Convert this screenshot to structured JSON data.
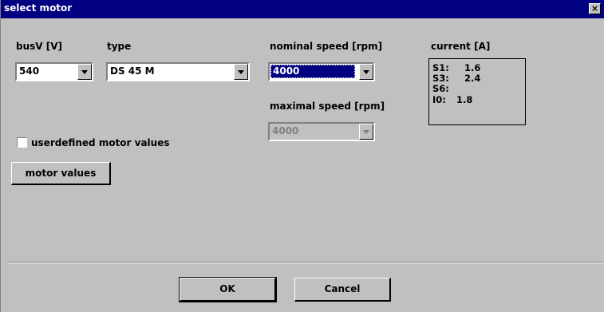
{
  "window": {
    "title": "select motor",
    "close_glyph": "×"
  },
  "busv": {
    "label": "busV [V]",
    "value": "540"
  },
  "type": {
    "label": "type",
    "value": "DS 45 M"
  },
  "nominal_speed": {
    "label": "nominal speed [rpm]",
    "value": "4000"
  },
  "maximal_speed": {
    "label": "maximal speed [rpm]",
    "value": "4000"
  },
  "current": {
    "label": "current [A]",
    "s1_label": "S1:",
    "s1_value": "1.6",
    "s3_label": "S3:",
    "s3_value": "2.4",
    "s6_label": "S6:",
    "s6_value": "",
    "i0_label": "I0:",
    "i0_value": "1.8"
  },
  "userdefined": {
    "label": "userdefined motor values",
    "checked": false
  },
  "buttons": {
    "motor_values": "motor values",
    "ok": "OK",
    "cancel": "Cancel"
  },
  "colors": {
    "title_bar": "#000080",
    "dialog_bg": "#c0c0c0",
    "selection": "#000080"
  },
  "icons": {
    "dropdown": "chevron-down-icon",
    "close": "close-icon"
  }
}
